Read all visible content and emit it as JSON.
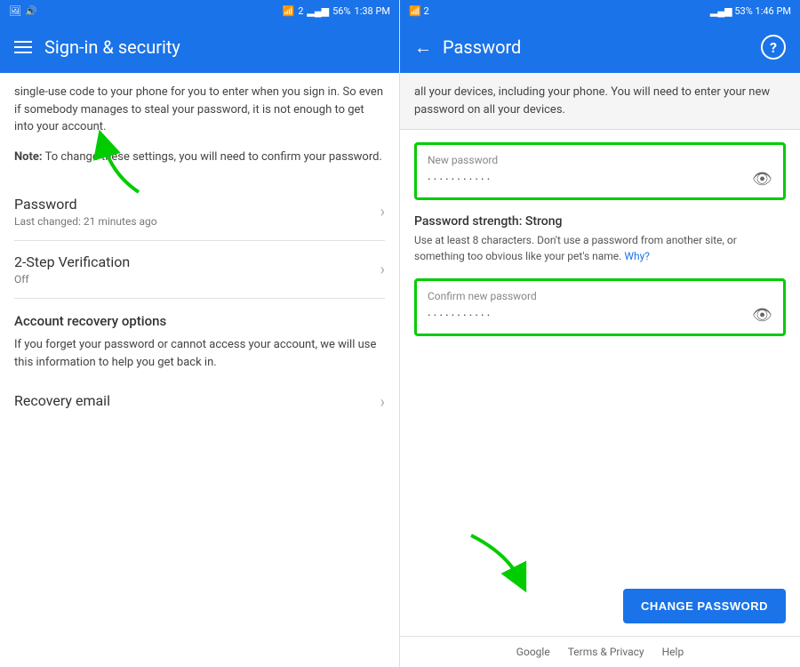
{
  "left": {
    "statusBar": {
      "time": "1:38 PM",
      "battery": "56%",
      "signal": "2"
    },
    "header": {
      "title": "Sign-in & security"
    },
    "bodyText": "single-use code to your phone for you to enter when you sign in. So even if somebody manages to steal your password, it is not enough to get into your account.",
    "noteText": "Note: To change these settings, you will need to confirm your password.",
    "menuItems": [
      {
        "title": "Password",
        "subtitle": "Last changed: 21 minutes ago"
      },
      {
        "title": "2-Step Verification",
        "subtitle": "Off"
      }
    ],
    "sectionHeading": "Account recovery options",
    "sectionBody": "If you forget your password or cannot access your account, we will use this information to help you get back in.",
    "recoveryEmail": "Recovery email"
  },
  "right": {
    "statusBar": {
      "time": "1:46 PM",
      "battery": "53%",
      "signal": "2"
    },
    "header": {
      "title": "Password",
      "helpLabel": "?"
    },
    "infoText": "all your devices, including your phone. You will need to enter your new password on all your devices.",
    "newPasswordField": {
      "label": "New password",
      "value": "···········",
      "eyeIcon": "👁"
    },
    "strengthLabel": "Password strength:",
    "strengthValue": "Strong",
    "strengthAdvice": "Use at least 8 characters. Don't use a password from another site, or something too obvious like your pet's name.",
    "strengthWhyLink": "Why?",
    "confirmPasswordField": {
      "label": "Confirm new password",
      "value": "···········",
      "eyeIcon": "👁"
    },
    "changeButton": "CHANGE PASSWORD",
    "footer": {
      "links": [
        "Google",
        "Terms & Privacy",
        "Help"
      ]
    }
  }
}
